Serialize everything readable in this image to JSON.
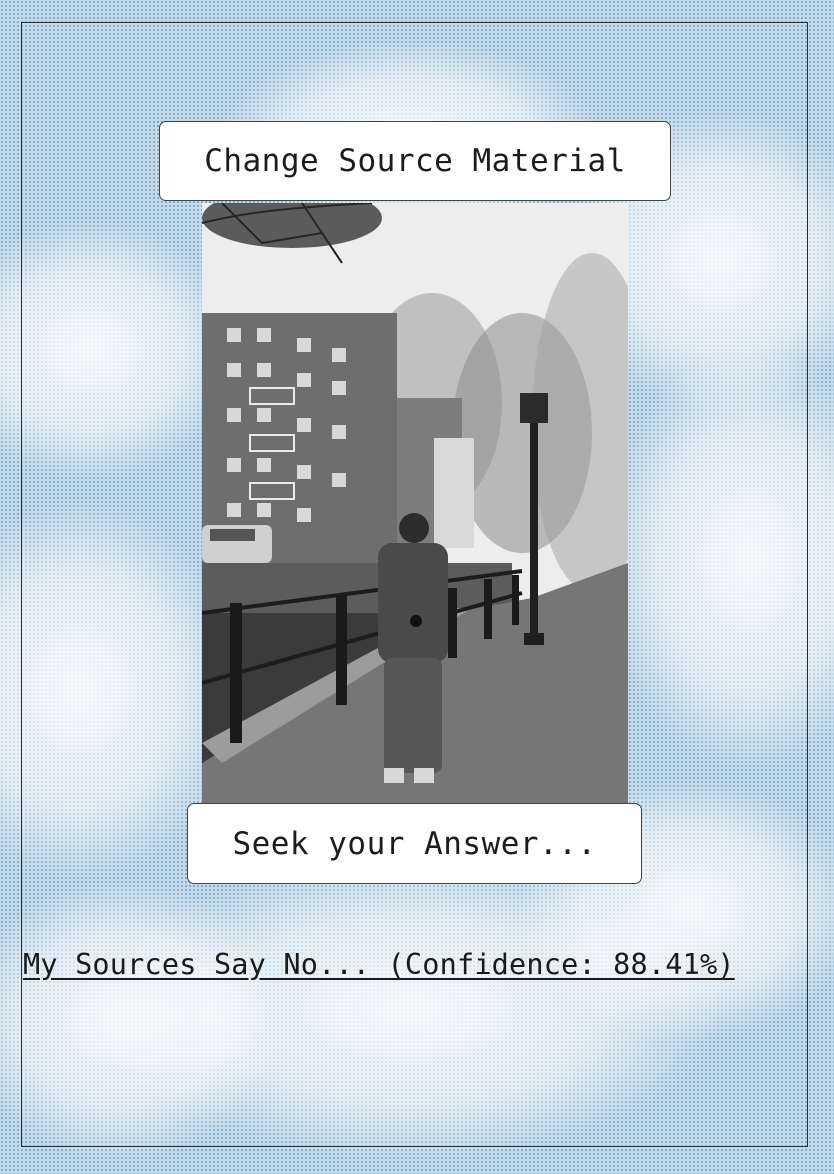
{
  "buttons": {
    "change_source": "Change Source Material",
    "seek_answer": "Seek your Answer..."
  },
  "result": {
    "text": "My Sources Say No... (Confidence: 88.41%)"
  },
  "colors": {
    "sky": "#c4dae8",
    "dots": "#4682af",
    "frame": "#2b2b2b"
  }
}
